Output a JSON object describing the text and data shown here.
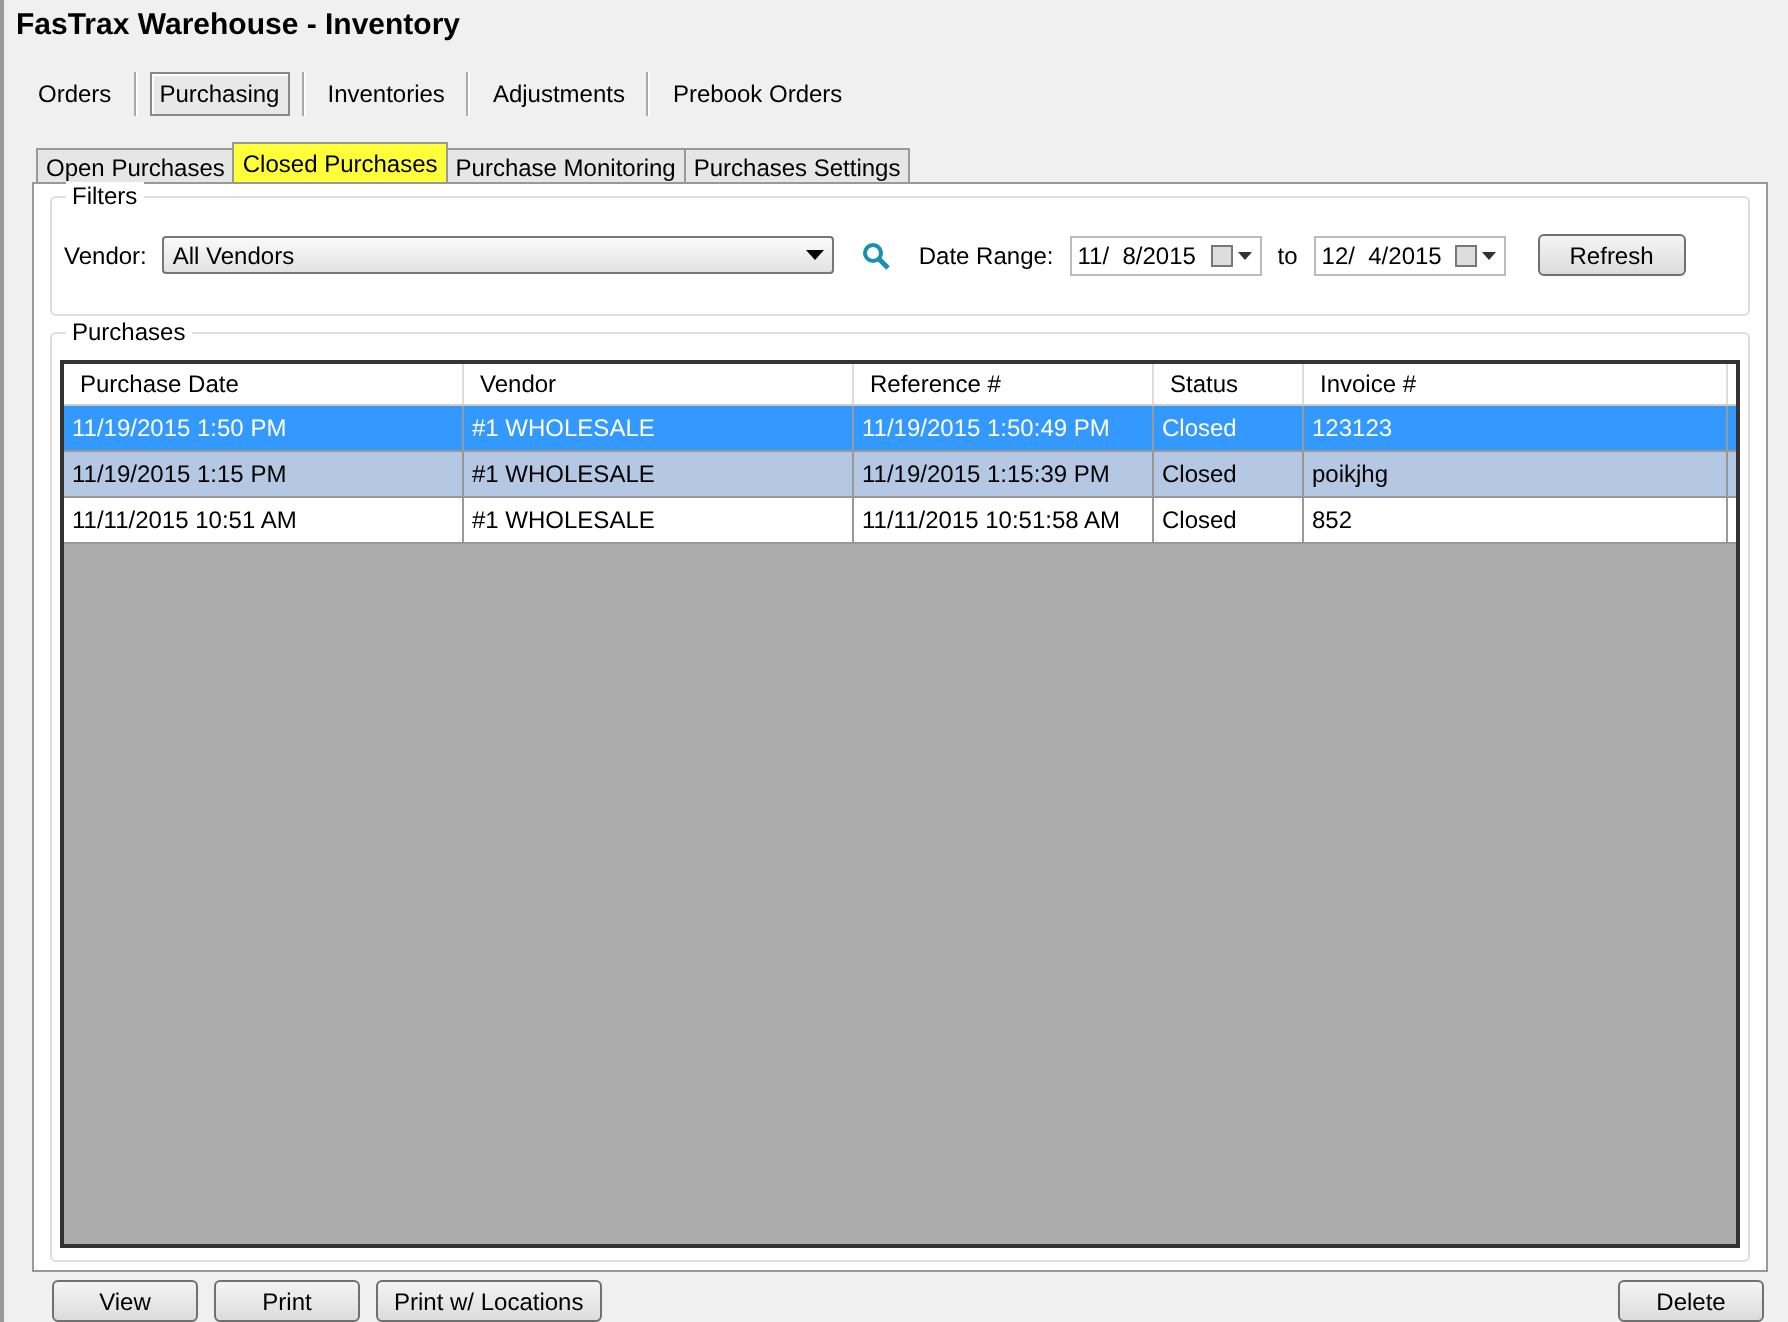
{
  "window": {
    "title": "FasTrax Warehouse - Inventory"
  },
  "module_tabs": [
    {
      "label": "Orders",
      "selected": false
    },
    {
      "label": "Purchasing",
      "selected": true
    },
    {
      "label": "Inventories",
      "selected": false
    },
    {
      "label": "Adjustments",
      "selected": false
    },
    {
      "label": "Prebook Orders",
      "selected": false
    }
  ],
  "tabs": [
    {
      "label": "Open Purchases",
      "selected": false,
      "highlighted": false
    },
    {
      "label": "Closed Purchases",
      "selected": true,
      "highlighted": true
    },
    {
      "label": "Purchase Monitoring",
      "selected": false,
      "highlighted": false
    },
    {
      "label": "Purchases Settings",
      "selected": false,
      "highlighted": false
    }
  ],
  "filters": {
    "title": "Filters",
    "vendor_label": "Vendor:",
    "vendor": "All Vendors",
    "date_range_label": "Date Range:",
    "date_from": "11/  8/2015",
    "to_label": "to",
    "date_to": "12/  4/2015",
    "refresh": "Refresh"
  },
  "purchases": {
    "title": "Purchases",
    "columns": [
      "Purchase Date",
      "Vendor",
      "Reference #",
      "Status",
      "Invoice #"
    ],
    "rows": [
      {
        "cells": [
          "11/19/2015 1:50 PM",
          "#1 WHOLESALE",
          "11/19/2015 1:50:49 PM",
          "Closed",
          "123123"
        ],
        "selected": true,
        "hover": false
      },
      {
        "cells": [
          "11/19/2015 1:15 PM",
          "#1 WHOLESALE",
          "11/19/2015 1:15:39 PM",
          "Closed",
          "poikjhg"
        ],
        "selected": false,
        "hover": true
      },
      {
        "cells": [
          "11/11/2015 10:51 AM",
          "#1 WHOLESALE",
          "11/11/2015 10:51:58 AM",
          "Closed",
          "852"
        ],
        "selected": false,
        "hover": false
      }
    ]
  },
  "buttons": [
    {
      "label": "View",
      "kind": "left"
    },
    {
      "label": "Print",
      "kind": "left"
    },
    {
      "label": "Print w/ Locations",
      "kind": "left"
    },
    {
      "label": "Delete",
      "kind": "right"
    }
  ]
}
